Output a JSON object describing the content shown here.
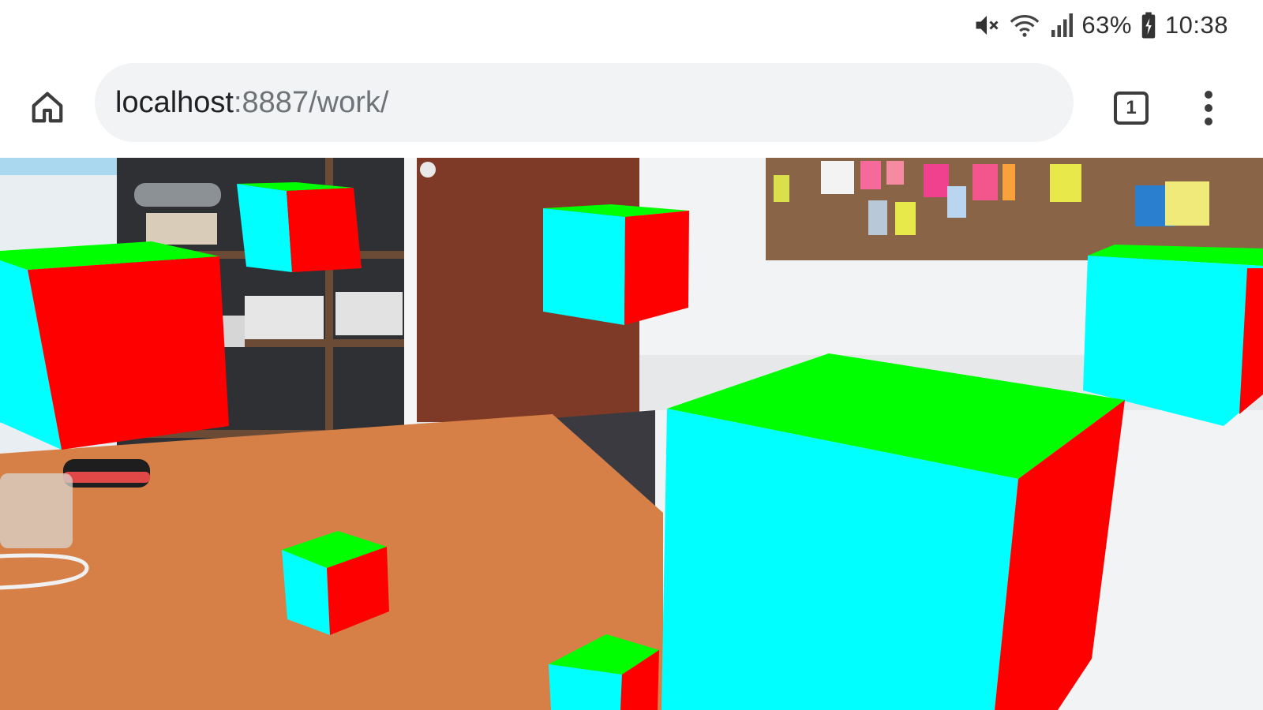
{
  "status_bar": {
    "battery": "63%",
    "time": "10:38",
    "icons": [
      "mute-vibrate-icon",
      "wifi-icon",
      "signal-icon",
      "battery-charging-icon"
    ]
  },
  "toolbar": {
    "url_host": "localhost",
    "url_rest": ":8887/work/",
    "tab_count": "1",
    "icons": [
      "home-icon",
      "tab-switcher-icon",
      "more-vert-icon"
    ]
  },
  "viewport": {
    "scene": "webxr-camera-feed",
    "cube_face_colors": {
      "top": "#00ff00",
      "front": "#00ffff",
      "side": "#ff0000"
    }
  },
  "colors": {
    "omnibox_bg": "#f1f3f4",
    "url_host_text": "#202124",
    "url_path_text": "#6f7378"
  }
}
